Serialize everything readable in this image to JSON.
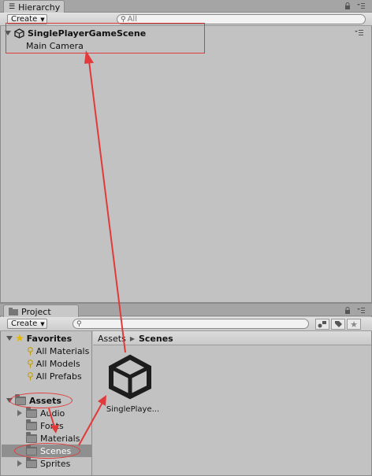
{
  "hierarchy": {
    "tab_label": "Hierarchy",
    "create_label": "Create",
    "search_placeholder": "All",
    "scene_name": "SinglePlayerGameScene",
    "items": [
      "Main Camera"
    ]
  },
  "project": {
    "tab_label": "Project",
    "create_label": "Create",
    "favorites_label": "Favorites",
    "favorites": [
      "All Materials",
      "All Models",
      "All Prefabs"
    ],
    "assets_label": "Assets",
    "asset_folders": [
      "Audio",
      "Fonts",
      "Materials",
      "Scenes",
      "Sprites"
    ],
    "breadcrumb": {
      "root": "Assets",
      "current": "Scenes"
    },
    "files": [
      {
        "name": "SinglePlaye...",
        "icon": "unity-scene-icon"
      }
    ]
  },
  "colors": {
    "annotation": "#e23a3a",
    "selection": "#8f8f8f",
    "panel": "#c2c2c2"
  }
}
